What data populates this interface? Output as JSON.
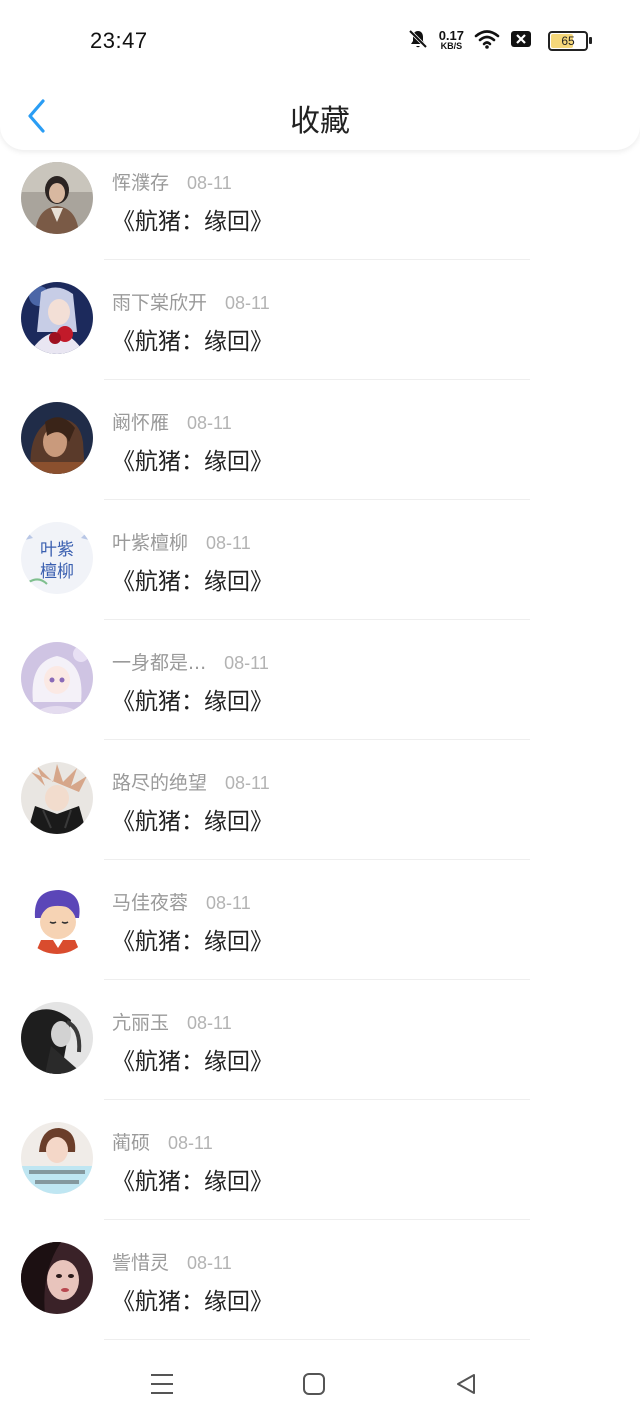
{
  "status_bar": {
    "time": "23:47",
    "net_speed_value": "0.17",
    "net_speed_unit": "KB/S",
    "battery_level": "65",
    "battery_fraction": 0.65
  },
  "header": {
    "title": "收藏"
  },
  "items": [
    {
      "name": "恽濮存",
      "date": "08-11",
      "title": "《航猪：缘回》",
      "avatar": "photo-girl-sepia"
    },
    {
      "name": "雨下棠欣开",
      "date": "08-11",
      "title": "《航猪：缘回》",
      "avatar": "anime-girl-roses"
    },
    {
      "name": "阚怀雁",
      "date": "08-11",
      "title": "《航猪：缘回》",
      "avatar": "photo-woman-dark"
    },
    {
      "name": "叶紫檀柳",
      "date": "08-11",
      "title": "《航猪：缘回》",
      "avatar": "calligraphy-text"
    },
    {
      "name": "一身都是...",
      "date": "08-11",
      "title": "《航猪：缘回》",
      "avatar": "anime-girl-white-hair"
    },
    {
      "name": "路尽的绝望",
      "date": "08-11",
      "title": "《航猪：缘回》",
      "avatar": "anime-boy-sketch"
    },
    {
      "name": "马佳夜蓉",
      "date": "08-11",
      "title": "《航猪：缘回》",
      "avatar": "cartoon-boy-purple-hair"
    },
    {
      "name": "亢丽玉",
      "date": "08-11",
      "title": "《航猪：缘回》",
      "avatar": "photo-woman-monochrome"
    },
    {
      "name": "蔺硕",
      "date": "08-11",
      "title": "《航猪：缘回》",
      "avatar": "photo-girl-with-text"
    },
    {
      "name": "訾惜灵",
      "date": "08-11",
      "title": "《航猪：缘回》",
      "avatar": "photo-woman-closeup"
    }
  ],
  "avatar_text": {
    "calligraphy_line1": "叶紫",
    "calligraphy_line2": "檀柳"
  },
  "system_nav": {
    "menu_icon": "menu-icon",
    "home_icon": "home-icon",
    "back_icon": "back-triangle-icon"
  },
  "colors": {
    "accent": "#2a9df4",
    "meta_text": "#9a9a9a",
    "title_text": "#222222"
  }
}
